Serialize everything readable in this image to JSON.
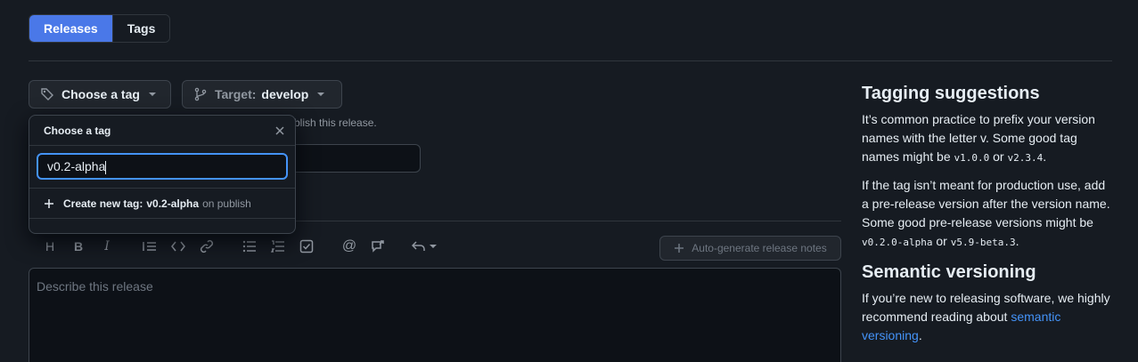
{
  "tabs": [
    {
      "label": "Releases",
      "active": true
    },
    {
      "label": "Tags",
      "active": false
    }
  ],
  "tag_button": {
    "label": "Choose a tag"
  },
  "target_button": {
    "prefix": "Target:",
    "branch": "develop"
  },
  "hint_text": "blish this release.",
  "dropdown": {
    "title": "Choose a tag",
    "input_value": "v0.2-alpha",
    "create_prefix": "Create new tag:",
    "create_tag": "v0.2-alpha",
    "create_suffix": "on publish"
  },
  "editor": {
    "autogen_label": "Auto-generate release notes",
    "placeholder": "Describe this release",
    "tools": [
      "heading-icon",
      "bold-icon",
      "italic-icon",
      "quote-icon",
      "code-icon",
      "link-icon",
      "bulleted-list-icon",
      "numbered-list-icon",
      "task-list-icon",
      "mention-icon",
      "reference-icon",
      "undo-icon"
    ]
  },
  "sidebar": {
    "tagging_title": "Tagging suggestions",
    "tagging_p1_a": "It’s common practice to prefix your version names with the letter v. Some good tag names might be ",
    "tagging_p1_code1": "v1.0.0",
    "tagging_p1_or": " or ",
    "tagging_p1_code2": "v2.3.4",
    "tagging_p1_end": ".",
    "tagging_p2_a": "If the tag isn’t meant for production use, add a pre-release version after the version name. Some good pre-release versions might be ",
    "tagging_p2_code1": "v0.2.0-alpha",
    "tagging_p2_or": " or ",
    "tagging_p2_code2": "v5.9-beta.3",
    "tagging_p2_end": ".",
    "semver_title": "Semantic versioning",
    "semver_p_a": "If you’re new to releasing software, we highly recommend reading about ",
    "semver_link": "semantic versioning",
    "semver_p_end": "."
  },
  "colors": {
    "accent": "#4493f8",
    "background": "#161b22",
    "input_bg": "#0d1117"
  }
}
